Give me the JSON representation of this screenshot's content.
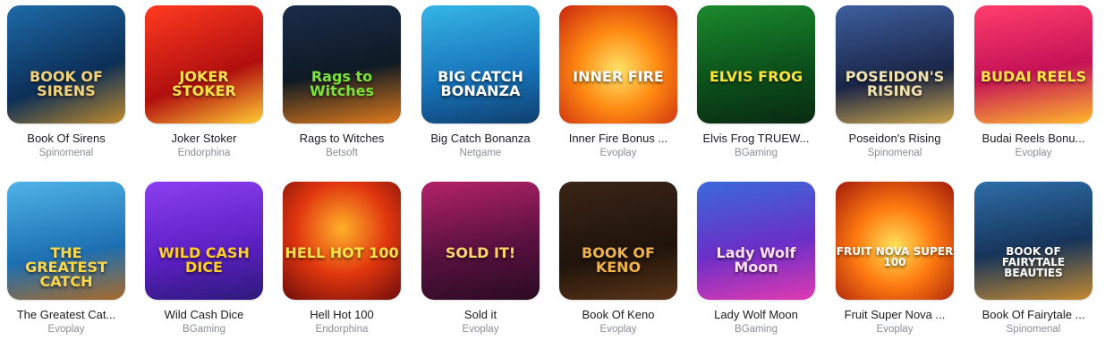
{
  "games": [
    {
      "title": "Book Of Sirens",
      "provider": "Spinomenal",
      "art": "BOOK OF SIRENS",
      "bg": "linear-gradient(160deg,#1e6aa8,#0c2f57 60%,#c08a2d)",
      "accent": "#f3d27a"
    },
    {
      "title": "Joker Stoker",
      "provider": "Endorphina",
      "art": "JOKER STOKER",
      "bg": "linear-gradient(160deg,#ff3b1f,#b10f0f 60%,#ffcc33)",
      "accent": "#ffe14a"
    },
    {
      "title": "Rags to Witches",
      "provider": "Betsoft",
      "art": "Rags to Witches",
      "bg": "linear-gradient(170deg,#1b2c4a,#0e1a24 55%,#e07a1c)",
      "accent": "#7be33a"
    },
    {
      "title": "Big Catch Bonanza",
      "provider": "Netgame",
      "art": "BIG CATCH BONANZA",
      "bg": "linear-gradient(170deg,#35b5e6,#1772b8 60%,#0f3f6e)",
      "accent": "#ffffff"
    },
    {
      "title": "Inner Fire Bonus ...",
      "provider": "Evoplay",
      "art": "INNER FIRE",
      "bg": "radial-gradient(circle at 50% 55%,#ffe46a,#ff8a12 45%,#c8250f)",
      "accent": "#ffffff"
    },
    {
      "title": "Elvis Frog TRUEW...",
      "provider": "BGaming",
      "art": "ELVIS FROG",
      "bg": "linear-gradient(170deg,#1a8a2d,#0b4d1a 60%,#0a2a12)",
      "accent": "#ffe23a"
    },
    {
      "title": "Poseidon's Rising",
      "provider": "Spinomenal",
      "art": "POSEIDON'S RISING",
      "bg": "linear-gradient(170deg,#3d5f9d,#1a2547 60%,#c9a44a)",
      "accent": "#f1e2ae"
    },
    {
      "title": "Budai Reels Bonu...",
      "provider": "Evoplay",
      "art": "BUDAI REELS",
      "bg": "linear-gradient(170deg,#ff3e6c,#c41256 55%,#ffb82d)",
      "accent": "#ffe24a"
    },
    {
      "title": "The Greatest Cat...",
      "provider": "Evoplay",
      "art": "THE GREATEST CATCH",
      "bg": "linear-gradient(170deg,#4fb3e8,#1d6fb1 60%,#a86a2a)",
      "accent": "#ffd84a"
    },
    {
      "title": "Wild Cash Dice",
      "provider": "BGaming",
      "art": "WILD CASH DICE",
      "bg": "linear-gradient(170deg,#8b3ff0,#5a1fc0 60%,#2d1a7a)",
      "accent": "#ffcf26"
    },
    {
      "title": "Hell Hot 100",
      "provider": "Endorphina",
      "art": "HELL HOT 100",
      "bg": "radial-gradient(circle at 50% 40%,#ffb12a,#e0360f 50%,#6e0d0a)",
      "accent": "#ffe14a"
    },
    {
      "title": "Sold it",
      "provider": "Evoplay",
      "art": "SOLD IT!",
      "bg": "linear-gradient(170deg,#b3226a,#5a1140 55%,#2a0b22)",
      "accent": "#ffd56b"
    },
    {
      "title": "Book Of Keno",
      "provider": "Evoplay",
      "art": "BOOK OF KENO",
      "bg": "linear-gradient(170deg,#3a2517,#1f130b 60%,#5a3518)",
      "accent": "#f0b34a"
    },
    {
      "title": "Lady Wolf Moon",
      "provider": "BGaming",
      "art": "Lady Wolf Moon",
      "bg": "linear-gradient(170deg,#3b6ad8,#6a2fc8 55%,#e03ab0)",
      "accent": "#ffe0f5"
    },
    {
      "title": "Fruit Super Nova ...",
      "provider": "Evoplay",
      "art": "FRUIT NOVA SUPER 100",
      "bg": "radial-gradient(circle at 50% 55%,#ffe35a,#ff7a10 45%,#a11a0c)",
      "accent": "#ffffff"
    },
    {
      "title": "Book Of Fairytale ...",
      "provider": "Spinomenal",
      "art": "BOOK OF FAIRYTALE BEAUTIES",
      "bg": "linear-gradient(170deg,#2d6ea8,#17345a 55%,#c38a33)",
      "accent": "#ffffff"
    }
  ]
}
